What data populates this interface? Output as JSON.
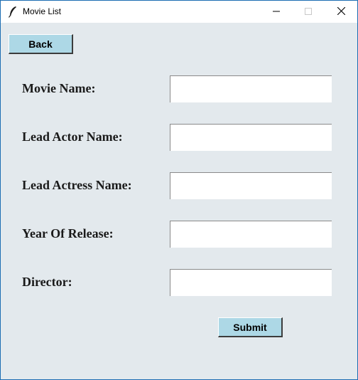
{
  "window": {
    "title": "Movie List",
    "app_icon": "feather-icon",
    "controls": {
      "minimize": "minimize-icon",
      "maximize": "maximize-icon",
      "close": "close-icon"
    }
  },
  "buttons": {
    "back_label": "Back",
    "submit_label": "Submit"
  },
  "form": {
    "fields": [
      {
        "label": "Movie Name:",
        "value": ""
      },
      {
        "label": "Lead Actor Name:",
        "value": ""
      },
      {
        "label": "Lead Actress Name:",
        "value": ""
      },
      {
        "label": "Year Of Release:",
        "value": ""
      },
      {
        "label": "Director:",
        "value": ""
      }
    ]
  },
  "colors": {
    "window_background": "#e3e9ed",
    "button_background": "#add8e6",
    "titlebar_background": "#ffffff",
    "window_border": "#1c6db3"
  }
}
